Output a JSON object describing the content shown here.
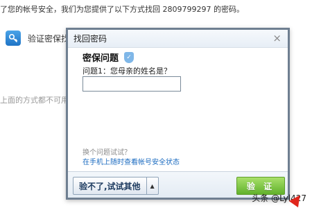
{
  "background": {
    "top_text": "了您的帐号安全，我们为您提供了以下方式找回 2809799297 的密码。",
    "option_label": "验证密保找",
    "note_text": "上面的方式都不可用"
  },
  "dialog": {
    "title": "找回密码",
    "close_glyph": "×",
    "section_title": "密保问题",
    "shield_glyph": "✓",
    "question": "问题1：您母亲的姓名是？",
    "answer_value": "",
    "alt_hint": "换个问题试试？",
    "alt_link": "在手机上随时查看帐号安全状态",
    "footer": {
      "try_other_label": "验不了,试试其他",
      "arrow_glyph": "▲",
      "verify_label": "验 证"
    }
  },
  "watermark": "头条 @Lyl427",
  "icons": {
    "close": "close-icon",
    "shield": "shield-icon",
    "key": "key-icon",
    "dropdown": "chevron-up-icon"
  },
  "colors": {
    "accent_green": "#61b12c",
    "link_blue": "#1b6bc0",
    "dialog_border": "#6f7f91",
    "arrow_red": "#e0261c"
  }
}
